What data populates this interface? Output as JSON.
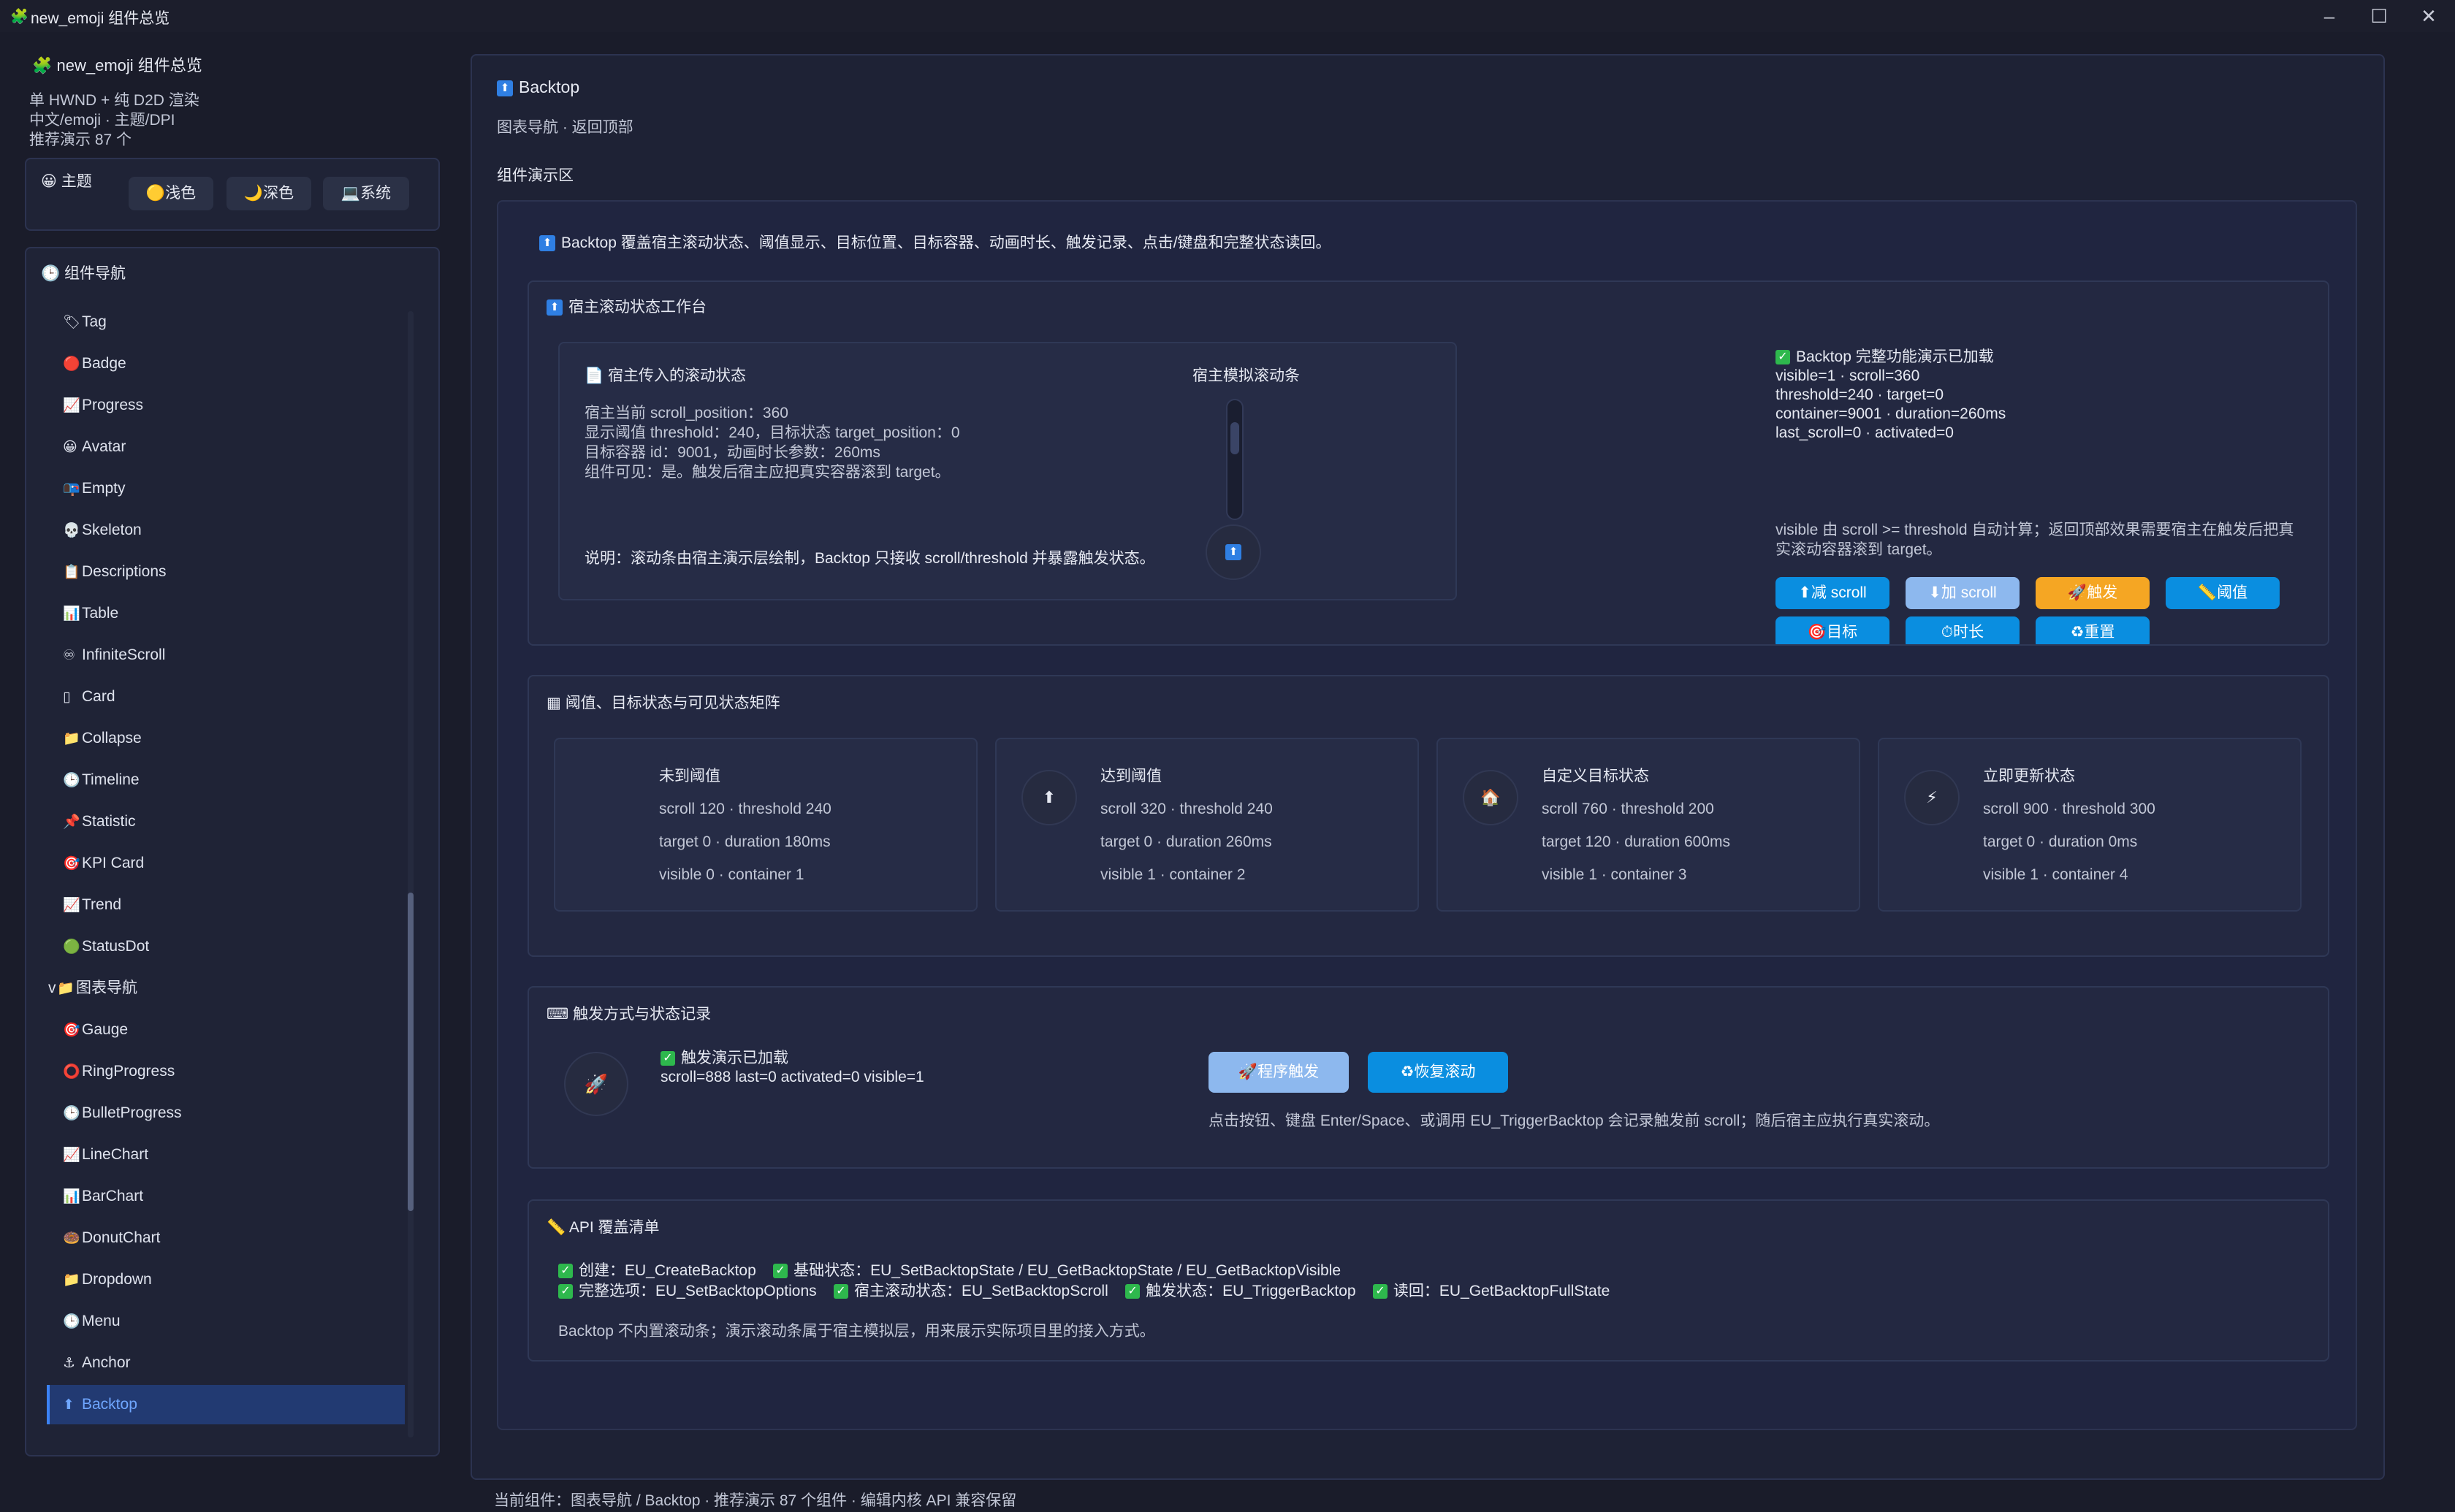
{
  "window": {
    "title": "new_emoji 组件总览",
    "app_icon": "puzzle-icon"
  },
  "sidebar": {
    "title": "new_emoji 组件总览",
    "info": [
      "单 HWND + 纯 D2D 渲染",
      "中文/emoji · 主题/DPI",
      "推荐演示 87 个"
    ],
    "theme": {
      "label": "主题",
      "buttons": [
        "浅色",
        "深色",
        "系统"
      ]
    },
    "nav_title": "组件导航",
    "nav_items": [
      {
        "icon": "🏷",
        "label": "Tag"
      },
      {
        "icon": "🔴",
        "label": "Badge"
      },
      {
        "icon": "📈",
        "label": "Progress"
      },
      {
        "icon": "😀",
        "label": "Avatar"
      },
      {
        "icon": "📭",
        "label": "Empty"
      },
      {
        "icon": "💀",
        "label": "Skeleton"
      },
      {
        "icon": "📋",
        "label": "Descriptions"
      },
      {
        "icon": "📊",
        "label": "Table"
      },
      {
        "icon": "♾",
        "label": "InfiniteScroll"
      },
      {
        "icon": "▯",
        "label": "Card"
      },
      {
        "icon": "📁",
        "label": "Collapse"
      },
      {
        "icon": "🕒",
        "label": "Timeline"
      },
      {
        "icon": "📌",
        "label": "Statistic"
      },
      {
        "icon": "🎯",
        "label": "KPI Card"
      },
      {
        "icon": "📈",
        "label": "Trend"
      },
      {
        "icon": "🟢",
        "label": "StatusDot"
      },
      {
        "icon": "📁",
        "label": "图表导航"
      },
      {
        "icon": "🎯",
        "label": "Gauge"
      },
      {
        "icon": "⭕",
        "label": "RingProgress"
      },
      {
        "icon": "🕒",
        "label": "BulletProgress"
      },
      {
        "icon": "📈",
        "label": "LineChart"
      },
      {
        "icon": "📊",
        "label": "BarChart"
      },
      {
        "icon": "🍩",
        "label": "DonutChart"
      },
      {
        "icon": "📁",
        "label": "Dropdown"
      },
      {
        "icon": "🕒",
        "label": "Menu"
      },
      {
        "icon": "⚓",
        "label": "Anchor"
      },
      {
        "icon": "⬆",
        "label": "Backtop"
      }
    ],
    "group_toggle": "v"
  },
  "main": {
    "title": "Backtop",
    "subtitle": "图表导航 · 返回顶部",
    "demo_area_label": "组件演示区",
    "intro": "Backtop 覆盖宿主滚动状态、阈值显示、目标位置、目标容器、动画时长、触发记录、点击/键盘和完整状态读回。",
    "workbench": {
      "title": "宿主滚动状态工作台",
      "host_state_title": "宿主传入的滚动状态",
      "host_state_lines": [
        "宿主当前 scroll_position：360",
        "显示阈值 threshold：240，目标状态 target_position：0",
        "目标容器 id：9001，动画时长参数：260ms",
        "组件可见：是。触发后宿主应把真实容器滚到 target。"
      ],
      "host_note": "说明：滚动条由宿主演示层绘制，Backtop 只接收 scroll/threshold 并暴露触发状态。",
      "scrollbar_title": "宿主模拟滚动条",
      "loaded_title": "Backtop 完整功能演示已加载",
      "status_lines": [
        "visible=1 · scroll=360",
        "threshold=240 · target=0",
        "container=9001 · duration=260ms",
        "last_scroll=0 · activated=0"
      ],
      "explain": [
        "visible 由 scroll >= threshold 自动计算；返回顶部效果需要宿主在触发后把真",
        "实滚动容器滚到 target。"
      ],
      "buttons": [
        {
          "label": "⬆减 scroll",
          "color": "#0a8ee0",
          "text": "#ffffff"
        },
        {
          "label": "⬇加 scroll",
          "color": "#8db8ee",
          "text": "#ffffff"
        },
        {
          "label": "🚀触发",
          "color": "#f5a623",
          "text": "#ffffff"
        },
        {
          "label": "📏阈值",
          "color": "#0a8ee0",
          "text": "#ffffff"
        },
        {
          "label": "🎯目标",
          "color": "#0a8ee0",
          "text": "#ffffff"
        },
        {
          "label": "⏱时长",
          "color": "#0a8ee0",
          "text": "#ffffff"
        },
        {
          "label": "♻重置",
          "color": "#0a8ee0",
          "text": "#ffffff"
        }
      ]
    },
    "matrix": {
      "title": "阈值、目标状态与可见状态矩阵",
      "cards": [
        {
          "icon": "",
          "title": "未到阈值",
          "lines": [
            "scroll 120 · threshold 240",
            "target 0 · duration 180ms",
            "visible 0 · container 1"
          ]
        },
        {
          "icon": "⬆",
          "title": "达到阈值",
          "lines": [
            "scroll 320 · threshold 240",
            "target 0 · duration 260ms",
            "visible 1 · container 2"
          ]
        },
        {
          "icon": "🏠",
          "title": "自定义目标状态",
          "lines": [
            "scroll 760 · threshold 200",
            "target 120 · duration 600ms",
            "visible 1 · container 3"
          ]
        },
        {
          "icon": "⚡",
          "title": "立即更新状态",
          "lines": [
            "scroll 900 · threshold 300",
            "target 0 · duration 0ms",
            "visible 1 · container 4"
          ]
        }
      ]
    },
    "trigger": {
      "title": "触发方式与状态记录",
      "loaded": "触发演示已加载",
      "status": "scroll=888 last=0 activated=0 visible=1",
      "btn_program": "🚀程序触发",
      "btn_restore": "♻恢复滚动",
      "note": "点击按钮、键盘 Enter/Space、或调用 EU_TriggerBacktop 会记录触发前 scroll；随后宿主应执行真实滚动。"
    },
    "api": {
      "title": "API 覆盖清单",
      "row1": [
        "创建：EU_CreateBacktop",
        "基础状态：EU_SetBacktopState / EU_GetBacktopState / EU_GetBacktopVisible"
      ],
      "row2": [
        "完整选项：EU_SetBacktopOptions",
        "宿主滚动状态：EU_SetBacktopScroll",
        "触发状态：EU_TriggerBacktop",
        "读回：EU_GetBacktopFullState"
      ],
      "note": "Backtop 不内置滚动条；演示滚动条属于宿主模拟层，用来展示实际项目里的接入方式。"
    }
  },
  "footer": {
    "status": "当前组件：图表导航 / Backtop · 推荐演示 87 个组件 · 编辑内核 API 兼容保留"
  },
  "colors": {
    "background": "#1a1c2a",
    "panel": "#1f2336",
    "accent": "#0a8ee0",
    "selected": "#223a72"
  }
}
